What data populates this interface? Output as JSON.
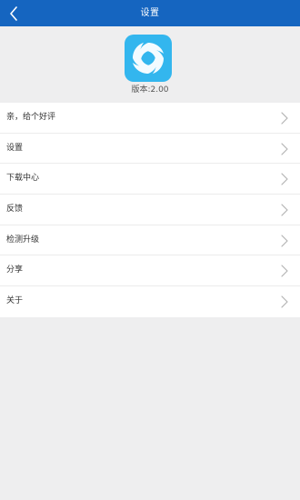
{
  "colors": {
    "accent": "#1565c0",
    "app_icon_bg": "#33b6ee"
  },
  "header": {
    "title": "设置",
    "back_icon": "chevron-left-icon"
  },
  "app": {
    "icon": "app-logo-icon",
    "version_text": "版本:2.00"
  },
  "menu": {
    "items": [
      {
        "label": "亲，给个好评",
        "icon": "chevron-right-icon"
      },
      {
        "label": "设置",
        "icon": "chevron-right-icon"
      },
      {
        "label": "下载中心",
        "icon": "chevron-right-icon"
      },
      {
        "label": "反馈",
        "icon": "chevron-right-icon"
      },
      {
        "label": "检测升级",
        "icon": "chevron-right-icon"
      },
      {
        "label": "分享",
        "icon": "chevron-right-icon"
      },
      {
        "label": "关于",
        "icon": "chevron-right-icon"
      }
    ]
  }
}
